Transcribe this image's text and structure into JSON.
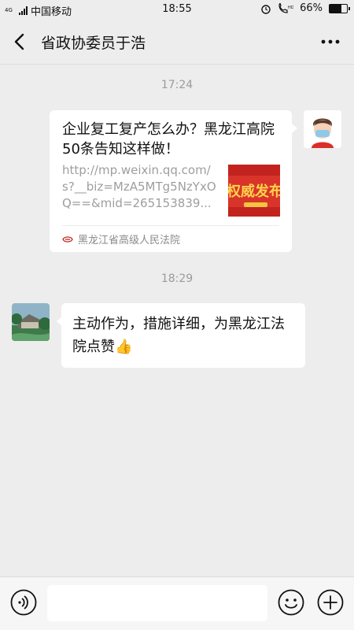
{
  "status_bar": {
    "network_tag": "4G",
    "carrier": "中国移动",
    "time": "18:55",
    "battery_percent": "66%",
    "battery_level": 0.66
  },
  "nav": {
    "title": "省政协委员于浩"
  },
  "messages": [
    {
      "timestamp": "17:24",
      "type": "link_card",
      "title": "企业复工复产怎么办？黑龙江高院50条告知这样做！",
      "url_preview": "http://mp.weixin.qq.com/s?__biz=MzA5MTg5NzYxOQ==&mid=265153839...",
      "thumbnail_text": "权威发布",
      "source": "黑龙江省高级人民法院"
    },
    {
      "timestamp": "18:29",
      "type": "text",
      "text": "主动作为，措施详细，为黑龙江法院点赞👍"
    }
  ],
  "colors": {
    "background": "#ededed",
    "bubble": "#ffffff",
    "timestamp": "#9b9b9b",
    "thumbnail_red": "#c2231e"
  }
}
